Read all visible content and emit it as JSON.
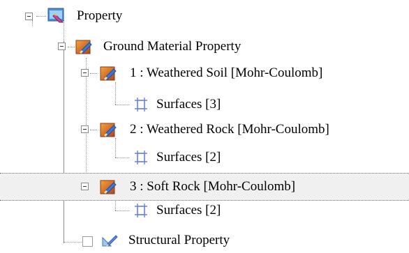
{
  "tree": {
    "root": {
      "label": "Property",
      "icon": "property-icon"
    },
    "ground": {
      "label": "Ground Material Property",
      "icon": "ground-material-icon"
    },
    "materials": [
      {
        "label": "1 : Weathered Soil [Mohr-Coulomb]",
        "surfaces_label": "Surfaces [3]"
      },
      {
        "label": "2 : Weathered Rock [Mohr-Coulomb]",
        "surfaces_label": "Surfaces [2]"
      },
      {
        "label": "3 : Soft Rock [Mohr-Coulomb]",
        "surfaces_label": "Surfaces [2]",
        "selected": true
      }
    ],
    "structural": {
      "label": "Structural Property",
      "checked": false
    }
  }
}
